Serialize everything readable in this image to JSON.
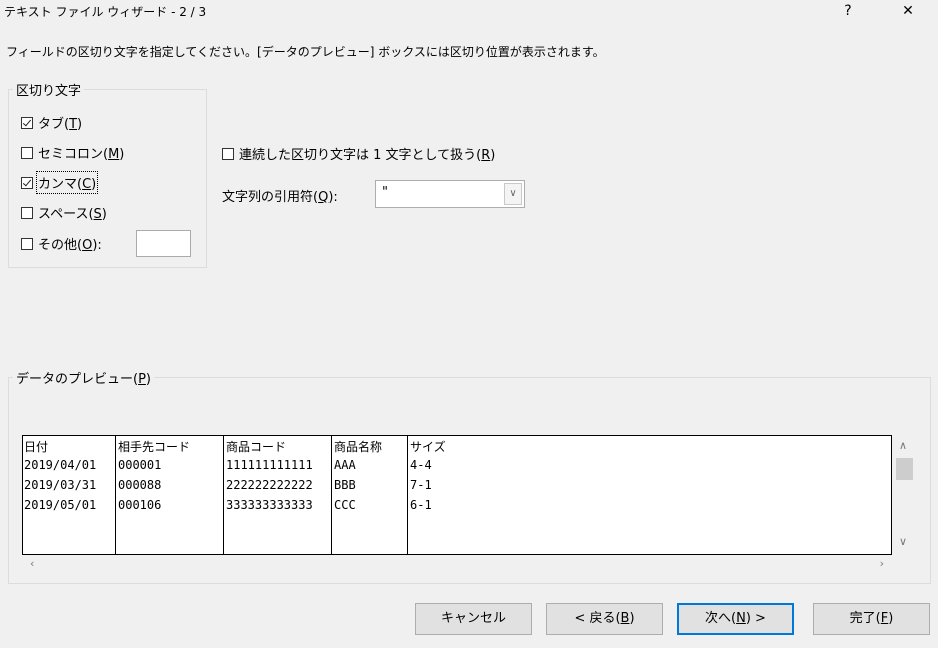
{
  "window": {
    "title": "テキスト ファイル ウィザード - 2 / 3",
    "help_label": "?",
    "close_label": "✕"
  },
  "instruction": "フィールドの区切り文字を指定してください。[データのプレビュー] ボックスには区切り位置が表示されます。",
  "delimiters": {
    "legend": "区切り文字",
    "tab": {
      "label": "タブ(",
      "key": "T",
      "end": ")",
      "checked": true
    },
    "semicolon": {
      "label": "セミコロン(",
      "key": "M",
      "end": ")",
      "checked": false
    },
    "comma": {
      "label": "カンマ(",
      "key": "C",
      "end": ")",
      "checked": true
    },
    "space": {
      "label": "スペース(",
      "key": "S",
      "end": ")",
      "checked": false
    },
    "other": {
      "label": "その他(",
      "key": "O",
      "end": "):",
      "checked": false,
      "value": ""
    }
  },
  "consecutive": {
    "label": "連続した区切り文字は 1 文字として扱う(",
    "key": "R",
    "end": ")",
    "checked": false
  },
  "qualifier": {
    "label": "文字列の引用符(",
    "key": "Q",
    "end": "):",
    "value": "\""
  },
  "preview": {
    "legend": "データのプレビュー(",
    "key": "P",
    "end": ")",
    "columns": [
      {
        "header": "日付",
        "cells": [
          "2019/04/01",
          "2019/03/31",
          "2019/05/01"
        ]
      },
      {
        "header": "相手先コード",
        "cells": [
          "000001",
          "000088",
          "000106"
        ]
      },
      {
        "header": "商品コード",
        "cells": [
          "111111111111",
          "222222222222",
          "333333333333"
        ]
      },
      {
        "header": "商品名称",
        "cells": [
          "AAA",
          "BBB",
          "CCC"
        ]
      },
      {
        "header": "サイズ",
        "cells": [
          "4-4",
          "7-1",
          "6-1"
        ]
      }
    ]
  },
  "buttons": {
    "cancel": "キャンセル",
    "back": {
      "label": "< 戻る(",
      "key": "B",
      "end": ")"
    },
    "next": {
      "label": "次へ(",
      "key": "N",
      "end": ") >"
    },
    "finish": {
      "label": "完了(",
      "key": "F",
      "end": ")"
    }
  }
}
